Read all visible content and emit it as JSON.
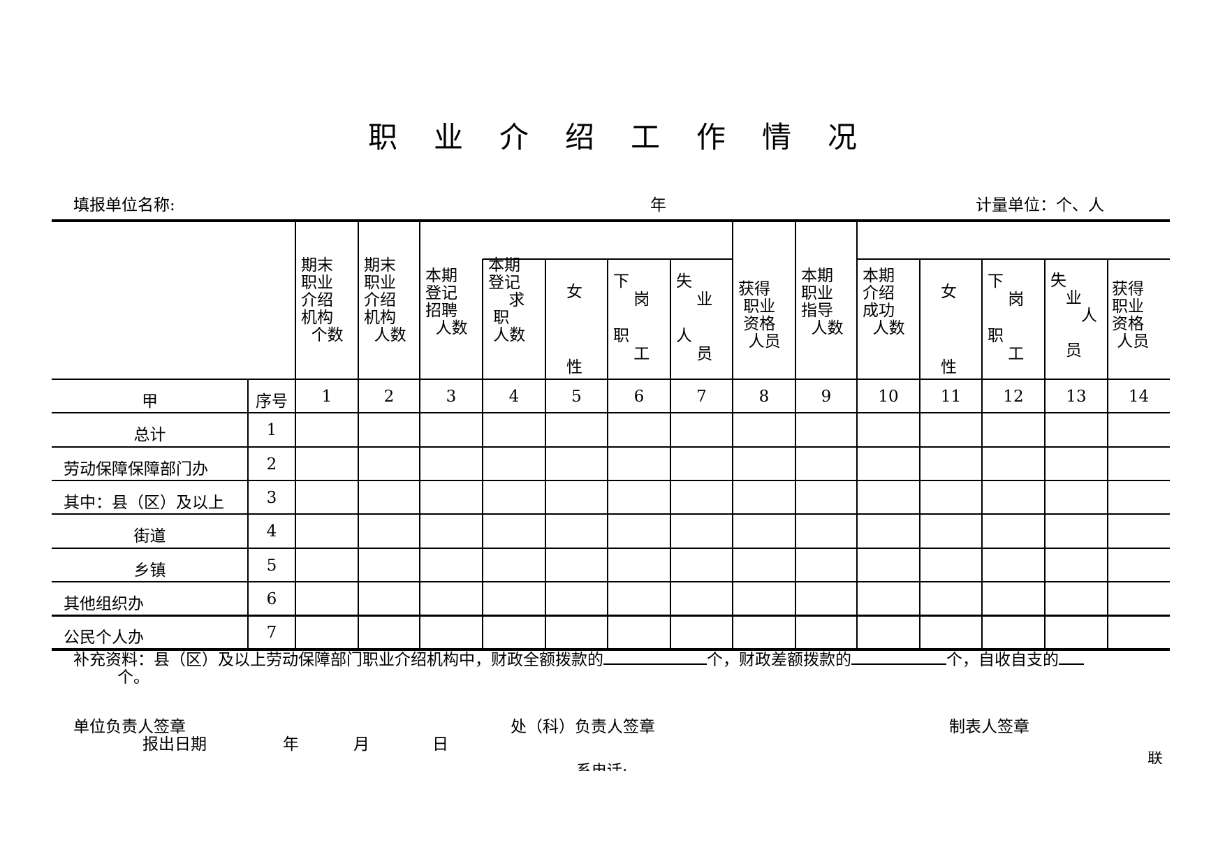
{
  "title": "职业介绍工作情况",
  "subheader": {
    "unit_name_label": "填报单位名称:",
    "year_label": "年",
    "measure_unit": "计量单位：个、人"
  },
  "table": {
    "header_columns": [
      {
        "no": "1",
        "label": "期末\n职业\n介绍\n机构\n  个数"
      },
      {
        "no": "2",
        "label": "期末\n职业\n介绍\n机构\n  人数"
      },
      {
        "no": "3",
        "label": "本期\n登记\n招聘\n  人数"
      },
      {
        "no": "4",
        "label": "本期\n登记\n    求\n 职\n 人数"
      },
      {
        "no": "5",
        "label": "女\n\n\n性"
      },
      {
        "no": "6",
        "label": "下\n    岗\n\n职\n    工"
      },
      {
        "no": "7",
        "label": "失\n    业\n\n人\n    员"
      },
      {
        "no": "8",
        "label": "获得\n 职业\n 资格\n  人员"
      },
      {
        "no": "9",
        "label": "本期\n职业\n指导\n  人数"
      },
      {
        "no": "10",
        "label": "本期\n介绍\n成功\n  人数"
      },
      {
        "no": "11",
        "label": "女\n\n\n性"
      },
      {
        "no": "12",
        "label": "下\n    岗\n\n职\n    工"
      },
      {
        "no": "13",
        "label": "失\n   业\n      人\n\n   员"
      },
      {
        "no": "14",
        "label": "获得\n职业\n资格\n 人员"
      }
    ],
    "row_header_label": "甲",
    "seq_header_label": "序号",
    "rows": [
      {
        "name": "总计",
        "seq": "1",
        "align": "center"
      },
      {
        "name": "劳动保障保障部门办",
        "seq": "2",
        "align": "left"
      },
      {
        "name": "其中：县（区）及以上",
        "seq": "3",
        "align": "left"
      },
      {
        "name": "街道",
        "seq": "4",
        "align": "center"
      },
      {
        "name": "乡镇",
        "seq": "5",
        "align": "center"
      },
      {
        "name": "其他组织办",
        "seq": "6",
        "align": "left"
      },
      {
        "name": "公民个人办",
        "seq": "7",
        "align": "left"
      }
    ]
  },
  "footer": {
    "supplement_part1": "补充资料：县（区）及以上劳动保障部门职业介绍机构中，财政全额拨款的",
    "supplement_part2": "个，财政差额拨款的",
    "supplement_part3": "个，自收自支的",
    "supplement_line2": "个。",
    "unit_head_sign": "单位负责人签章",
    "dept_head_sign": "处（科）负责人签章",
    "preparer_sign": "制表人签章",
    "report_date_label": "报出日期",
    "year": "年",
    "month": "月",
    "day": "日",
    "contact_phone_partial": "系电话:",
    "contact_partial_right": "联"
  }
}
